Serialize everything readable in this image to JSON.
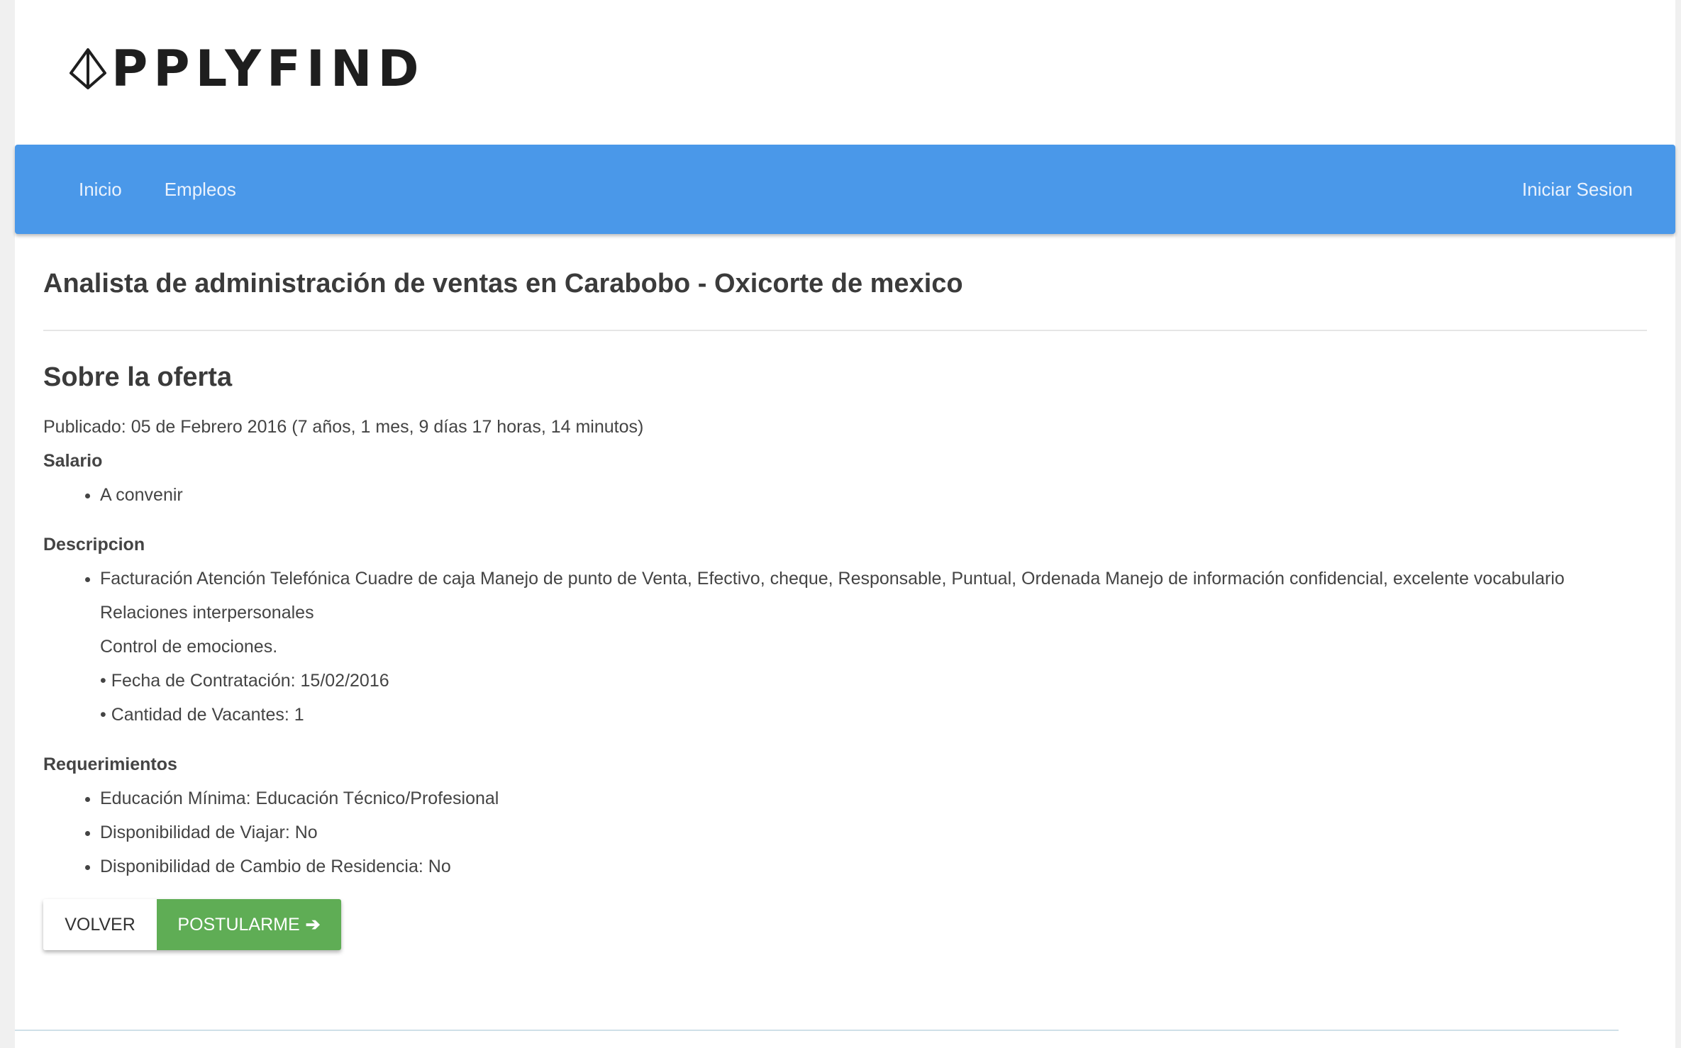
{
  "logo": {
    "text": "PPLYFIND"
  },
  "nav": {
    "home": "Inicio",
    "jobs": "Empleos",
    "login": "Iniciar Sesion"
  },
  "job": {
    "title": "Analista de administración de ventas en Carabobo - Oxicorte de mexico"
  },
  "offer": {
    "section_title": "Sobre la oferta",
    "published": "Publicado: 05 de Febrero 2016 (7 años, 1 mes, 9 días 17 horas, 14 minutos)",
    "salary_label": "Salario",
    "salary_items": [
      "A convenir"
    ],
    "description_label": "Descripcion",
    "description_lines": [
      "Facturación Atención Telefónica Cuadre de caja Manejo de punto de Venta, Efectivo, cheque, Responsable, Puntual, Ordenada Manejo de información confidencial, excelente vocabulario",
      "Relaciones interpersonales",
      "Control de emociones.",
      "• Fecha de Contratación: 15/02/2016",
      "• Cantidad de Vacantes: 1"
    ],
    "requirements_label": "Requerimientos",
    "requirements_items": [
      "Educación Mínima: Educación Técnico/Profesional",
      "Disponibilidad de Viajar: No",
      "Disponibilidad de Cambio de Residencia: No"
    ]
  },
  "actions": {
    "back_label": "VOLVER",
    "apply_label": "POSTULARME",
    "apply_icon": "arrow-right-icon"
  },
  "colors": {
    "navbar": "#4a98e9",
    "apply_button": "#5fad55"
  }
}
